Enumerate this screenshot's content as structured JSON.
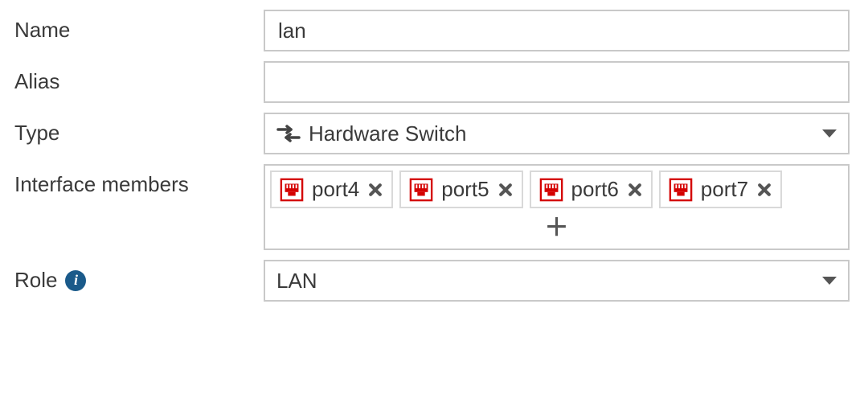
{
  "labels": {
    "name": "Name",
    "alias": "Alias",
    "type": "Type",
    "members": "Interface members",
    "role": "Role"
  },
  "fields": {
    "name": "lan",
    "alias": "",
    "type": "Hardware Switch",
    "role": "LAN"
  },
  "members": [
    {
      "label": "port4"
    },
    {
      "label": "port5"
    },
    {
      "label": "port6"
    },
    {
      "label": "port7"
    }
  ],
  "icons": {
    "switch": "⇄",
    "plus": "＋"
  }
}
